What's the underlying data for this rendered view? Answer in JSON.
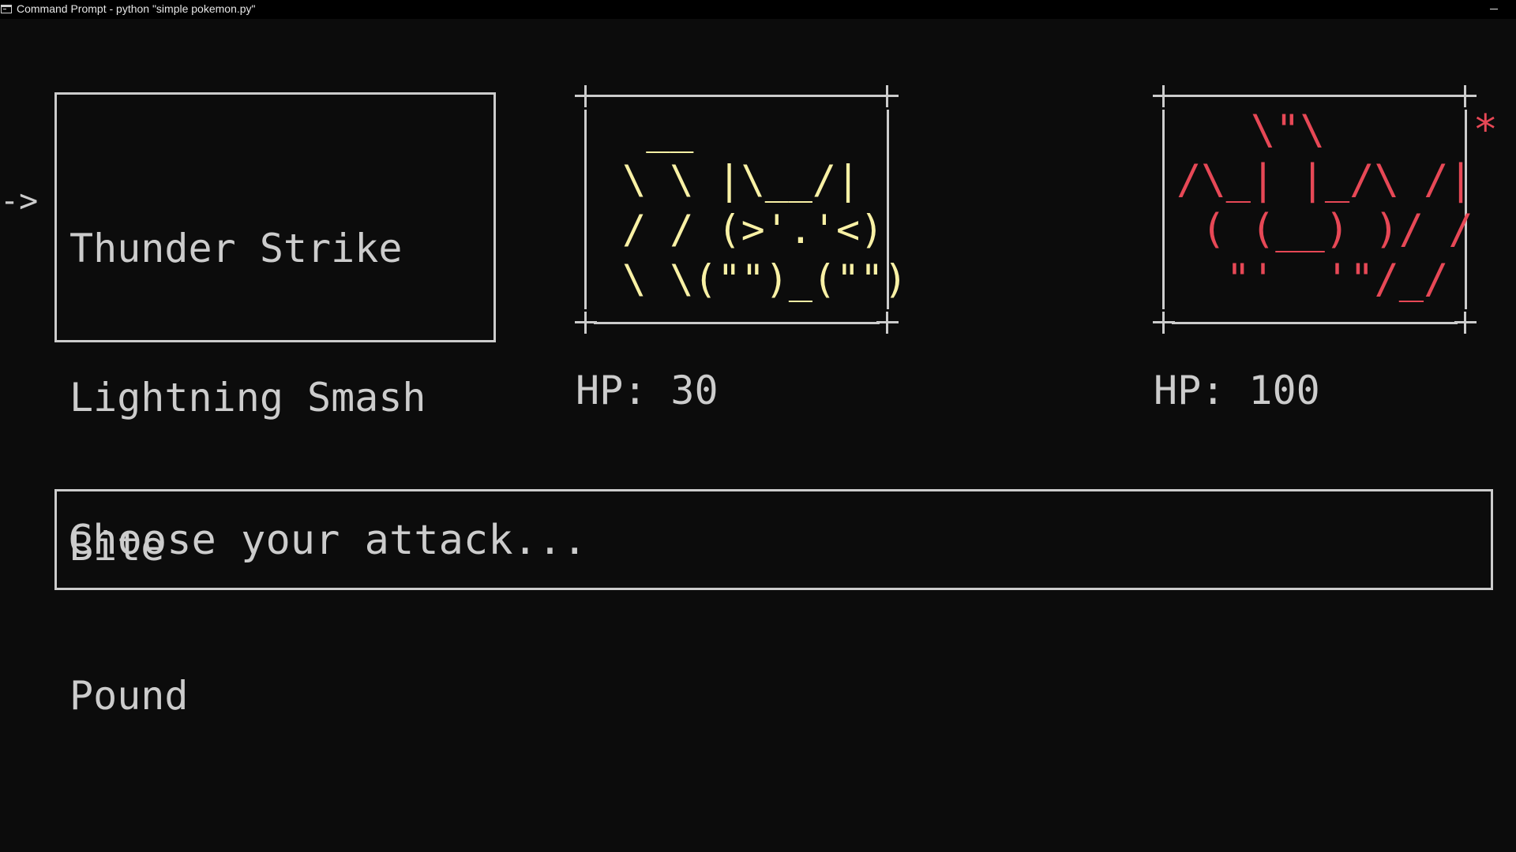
{
  "window": {
    "title": "Command Prompt - python  \"simple pokemon.py\""
  },
  "menu": {
    "cursor": "->",
    "attacks": [
      "Thunder Strike",
      "Lightning Smash",
      "Bite",
      "Pound"
    ],
    "selected_index": 1
  },
  "player": {
    "art": "  __\n \\ \\ |\\__/|\n / / (>'.'<)\n \\ \\(\"\")_(\"\")",
    "hp_text": "HP: 30",
    "color": "#f9f1a5"
  },
  "enemy": {
    "art": "   \\\"\\      *\n/\\_| |_/\\ /|\n ( (__) )/ /\n  \"'  '\"/_/",
    "hp_text": "HP: 100",
    "color": "#e74856"
  },
  "message": {
    "text": "Choose your attack..."
  },
  "colors": {
    "background": "#0c0c0c",
    "foreground": "#cccccc",
    "titlebar": "#000000"
  }
}
